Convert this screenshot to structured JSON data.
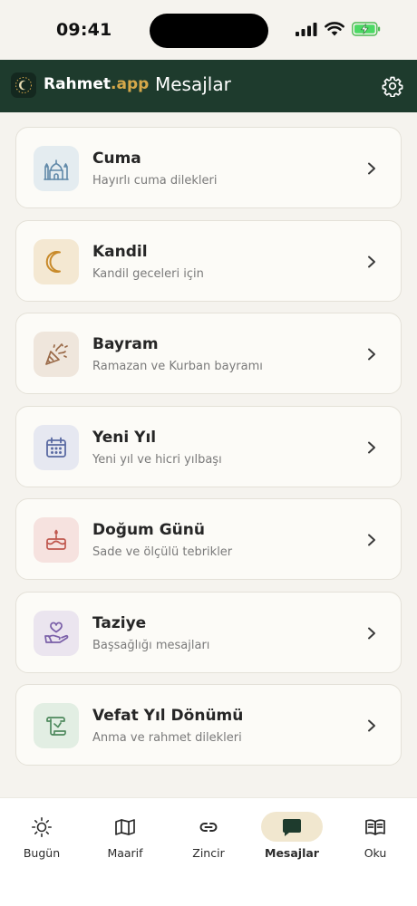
{
  "status": {
    "time": "09:41"
  },
  "header": {
    "brand_main": "Rahmet",
    "brand_accent": ".app",
    "title": "Mesajlar"
  },
  "cards": [
    {
      "title": "Cuma",
      "subtitle": "Hayırlı cuma dilekleri",
      "icon": "mosque-icon",
      "color": "#5f88a8",
      "bg": "#e4ecf0"
    },
    {
      "title": "Kandil",
      "subtitle": "Kandil geceleri için",
      "icon": "crescent-moon-icon",
      "color": "#c88a2a",
      "bg": "#f4e8d2"
    },
    {
      "title": "Bayram",
      "subtitle": "Ramazan ve Kurban bayramı",
      "icon": "party-popper-icon",
      "color": "#9a6a48",
      "bg": "#efe6dc"
    },
    {
      "title": "Yeni Yıl",
      "subtitle": "Yeni yıl ve hicri yılbaşı",
      "icon": "calendar-icon",
      "color": "#5a6aa2",
      "bg": "#e6e8f1"
    },
    {
      "title": "Doğum Günü",
      "subtitle": "Sade ve ölçülü tebrikler",
      "icon": "birthday-cake-icon",
      "color": "#c0584f",
      "bg": "#f6e2df"
    },
    {
      "title": "Taziye",
      "subtitle": "Başsağlığı mesajları",
      "icon": "hand-heart-icon",
      "color": "#7a5fa8",
      "bg": "#ebe5ef"
    },
    {
      "title": "Vefat Yıl Dönümü",
      "subtitle": "Anma ve rahmet dilekleri",
      "icon": "scroll-icon",
      "color": "#4f8a5e",
      "bg": "#e2eee3"
    }
  ],
  "tabs": [
    {
      "label": "Bugün",
      "icon": "sun-icon",
      "active": false
    },
    {
      "label": "Maarif",
      "icon": "open-map-book-icon",
      "active": false
    },
    {
      "label": "Zincir",
      "icon": "chain-link-icon",
      "active": false
    },
    {
      "label": "Mesajlar",
      "icon": "message-icon",
      "active": true
    },
    {
      "label": "Oku",
      "icon": "book-icon",
      "active": false
    }
  ]
}
